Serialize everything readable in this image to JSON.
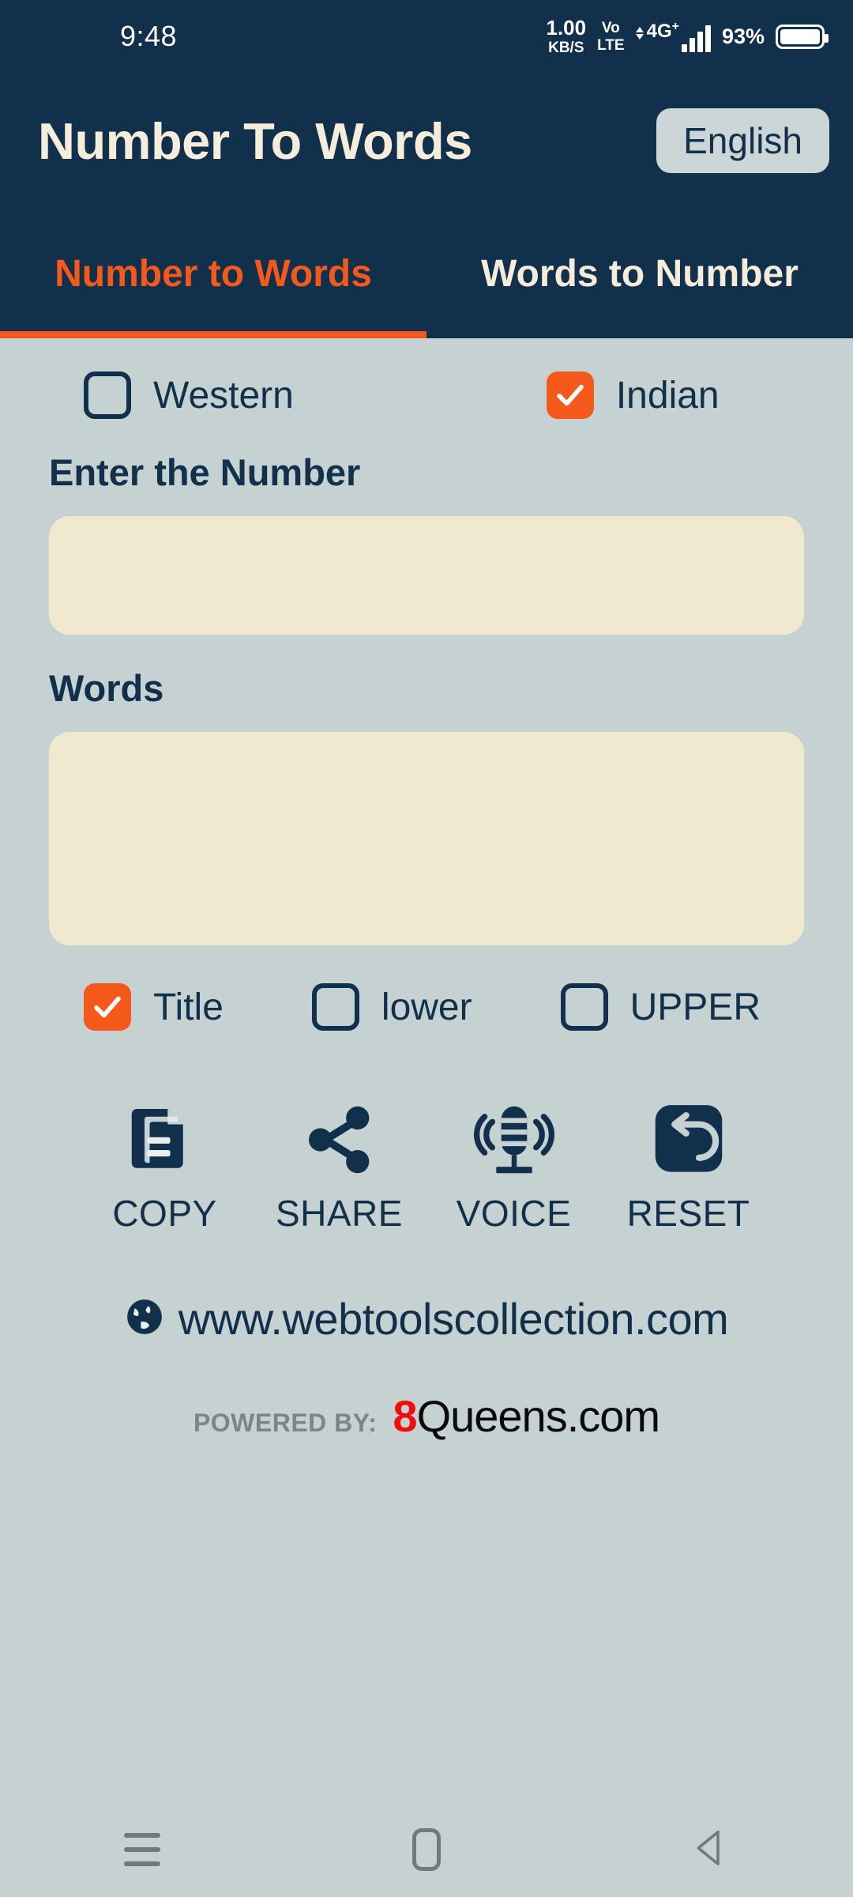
{
  "status_bar": {
    "time": "9:48",
    "net_speed_value": "1.00",
    "net_speed_unit": "KB/S",
    "volte_top": "Vo",
    "volte_bottom": "LTE",
    "network_type": "4G",
    "network_plus": "+",
    "battery_percent": "93%"
  },
  "header": {
    "title": "Number To Words",
    "language_button": "English"
  },
  "tabs": [
    {
      "label": "Number to Words",
      "active": true
    },
    {
      "label": "Words to Number",
      "active": false
    }
  ],
  "system_options": [
    {
      "label": "Western",
      "checked": false
    },
    {
      "label": "Indian",
      "checked": true
    }
  ],
  "number_field": {
    "label": "Enter the Number",
    "value": "",
    "placeholder": ""
  },
  "words_field": {
    "label": "Words",
    "value": "",
    "placeholder": ""
  },
  "case_options": [
    {
      "label": "Title",
      "checked": true
    },
    {
      "label": "lower",
      "checked": false
    },
    {
      "label": "UPPER",
      "checked": false
    }
  ],
  "actions": [
    {
      "label": "COPY",
      "icon": "copy-icon"
    },
    {
      "label": "SHARE",
      "icon": "share-icon"
    },
    {
      "label": "VOICE",
      "icon": "microphone-icon"
    },
    {
      "label": "RESET",
      "icon": "reset-icon"
    }
  ],
  "footer": {
    "website": "www.webtoolscollection.com",
    "website_icon": "globe-icon",
    "powered_by_label": "POWERED BY:",
    "brand_prefix": "8",
    "brand_rest": "Queens.com"
  },
  "nav_bar": {
    "recents": "recents-icon",
    "home": "home-icon",
    "back": "back-icon"
  },
  "colors": {
    "navy": "#11304c",
    "orange": "#f4581b",
    "background": "#c6d1d1",
    "field": "#f0e9d0",
    "cream_text": "#f5ecd9",
    "brand_red": "#f20d0d"
  }
}
